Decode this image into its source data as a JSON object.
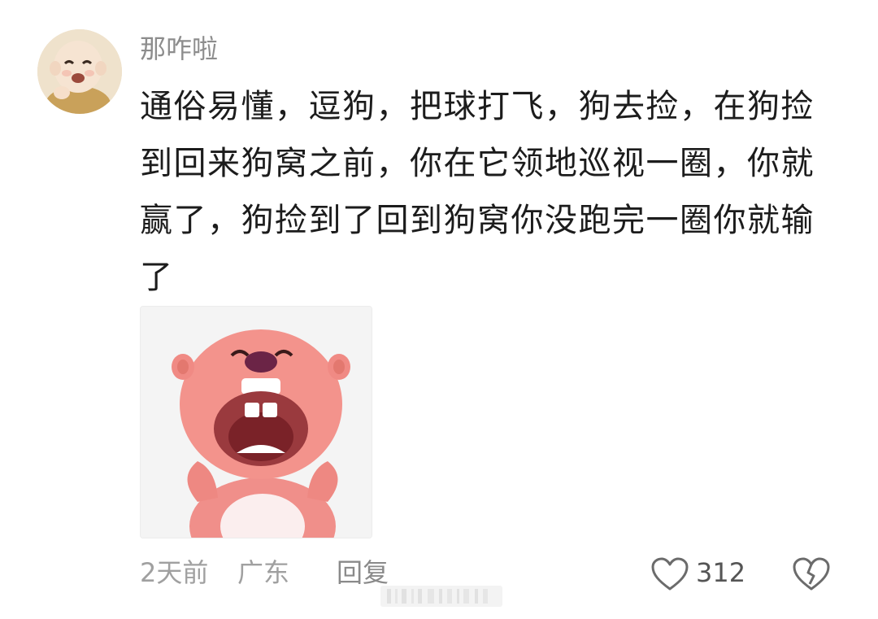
{
  "comment": {
    "username": "那咋啦",
    "text_lines": [
      "通俗易懂，逗狗，把球打飞，狗去捡，在狗捡",
      "到回来狗窝之前，你在它领地巡视一圈，你就",
      "赢了，狗捡到了回到狗窝你没跑完一圈你就输",
      "了"
    ],
    "time": "2天前",
    "location": "广东",
    "reply_label": "回复",
    "like_count": "312",
    "avatar_icon": "baby-avatar",
    "sticker_icon": "pink-beaver-laughing-sticker"
  },
  "colors": {
    "username": "#8d8d8d",
    "text": "#1c1c1c",
    "meta": "#a0a0a0",
    "icon": "#6b6b6b"
  }
}
